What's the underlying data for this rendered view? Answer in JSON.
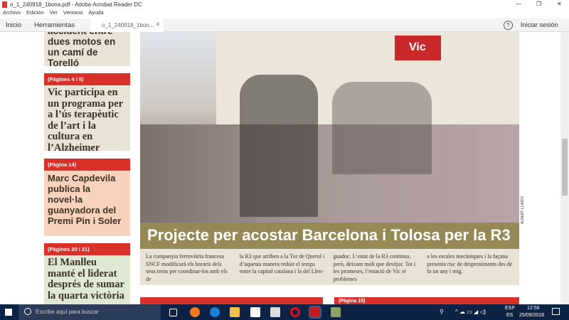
{
  "window": {
    "title": "o_1_240918_1bona.pdf - Adobe Acrobat Reader DC",
    "minimize": "—",
    "maximize": "❐",
    "close": "✕"
  },
  "menu": [
    "Archivo",
    "Edición",
    "Ver",
    "Ventana",
    "Ayuda"
  ],
  "tabs": {
    "home": "Inicio",
    "tools": "Herramientas",
    "document": "o_1_240918_1bon...",
    "close": "×",
    "help": "?",
    "signin": "Iniciar sesión"
  },
  "sidebar": [
    {
      "tag": "",
      "headline": "accident entre dues motos en un camí de Torelló"
    },
    {
      "tag": "(Pàgines 4 i 5)",
      "headline": "Vic participa en un programa per a l’ús terapèutic de l’art i la cultura en l’Alzheimer"
    },
    {
      "tag": "(Pàgina 14)",
      "headline": "Marc Capdevila publica la novel·la guanyadora del Premi Pin i Soler"
    },
    {
      "tag": "(Pàgines 20 i 21)",
      "headline": "El Manlleu manté el liderat després de sumar la quarta victòria"
    }
  ],
  "article": {
    "photo_sign": "Vic",
    "photo_credit": "ALBERT LLIMÓS",
    "headline": "Projecte per acostar Barcelona i Tolosa per la R3",
    "columns": [
      "La companyia ferroviària francesa SNCF modificarà els horaris dels seus trens per coordinar-los amb els de",
      "la R3 que arriben a la Tor de Querol i d’aquesta manera reduir el temps entre la capital catalana i la del Llen-",
      "guadoc. L’estat de la R3 continua, però, deixant molt que desitjar. Tot i les promeses, l’estació de Vic té problemes",
      "a les escales mecàniques i la façana presenta risc de despreniments des de fa un any i mig."
    ],
    "next_tag": "(Pàgina 15)"
  },
  "taskbar": {
    "search_placeholder": "Escribe aquí para buscar",
    "lang1": "ESP",
    "lang2": "ES",
    "time": "12:56",
    "date": "25/09/2018"
  },
  "colors": {
    "red": "#d9302a",
    "olive": "#958a55",
    "beige": "#e8e3d4",
    "taskbar": "#0d2345"
  }
}
